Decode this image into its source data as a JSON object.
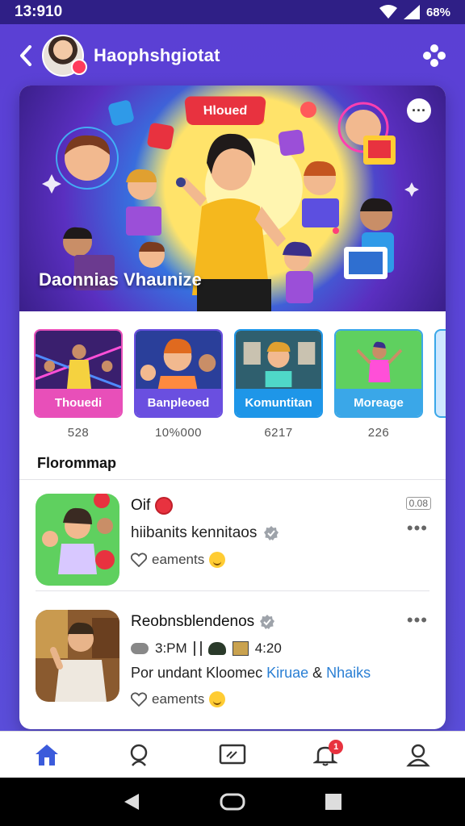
{
  "status_bar": {
    "time": "13:910",
    "battery": "68%"
  },
  "header": {
    "title": "Haophshgiotat"
  },
  "hero": {
    "badge": "Hloued",
    "title": "Daonnias Vhaunize"
  },
  "categories": [
    {
      "label": "Thouedi",
      "count": "528",
      "color": "#e84fb9"
    },
    {
      "label": "Banpleoed",
      "count": "10%000",
      "color": "#6a4fe0"
    },
    {
      "label": "Komuntitan",
      "count": "6217",
      "color": "#1e96e8"
    },
    {
      "label": "Moreage",
      "count": "226",
      "color": "#3aa7e8"
    }
  ],
  "section": {
    "title": "Florommap"
  },
  "feed": [
    {
      "title": "Oif",
      "badge": "0.08",
      "subtitle": "hiibanits kennitaos",
      "meta": "eaments"
    },
    {
      "title": "Reobnsblendenos",
      "stats_left": "3:PM",
      "stats_right": "4:20",
      "subtitle_prefix": "Por undant Kloomec",
      "link1": "Kiruae",
      "amp": "&",
      "link2": "Nhaiks",
      "meta": "eaments"
    }
  ],
  "bottom_nav": {
    "notification_count": "1"
  }
}
